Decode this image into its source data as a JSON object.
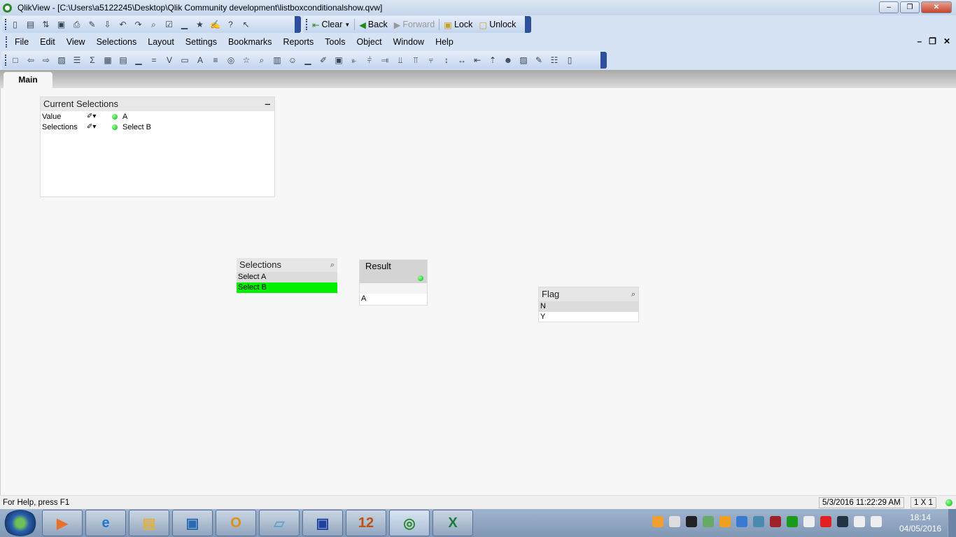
{
  "window": {
    "title": "QlikView - [C:\\Users\\a5122245\\Desktop\\Qlik Community development\\listboxconditionalshow.qvw]",
    "min": "–",
    "max": "❐",
    "close": "✕"
  },
  "toolbar_standard": [
    {
      "n": "new-icon",
      "g": "▯"
    },
    {
      "n": "open-icon",
      "g": "▤"
    },
    {
      "n": "reload-icon",
      "g": "⇅"
    },
    {
      "n": "save-icon",
      "g": "▣"
    },
    {
      "n": "print-icon",
      "g": "⎙"
    },
    {
      "n": "edit-script-icon",
      "g": "✎"
    },
    {
      "n": "reload-data-icon",
      "g": "⇩"
    },
    {
      "n": "undo-icon",
      "g": "↶"
    },
    {
      "n": "redo-icon",
      "g": "↷"
    },
    {
      "n": "search-icon",
      "g": "⌕"
    },
    {
      "n": "checkmark-icon",
      "g": "☑"
    },
    {
      "n": "chart-wizard-icon",
      "g": "▁"
    },
    {
      "n": "bookmark-star-icon",
      "g": "★"
    },
    {
      "n": "notes-icon",
      "g": "✍"
    },
    {
      "n": "help-icon",
      "g": "?"
    },
    {
      "n": "context-help-icon",
      "g": "↖"
    }
  ],
  "navigation": {
    "clear": "Clear",
    "back": "Back",
    "forward": "Forward",
    "lock": "Lock",
    "unlock": "Unlock"
  },
  "menu": [
    "File",
    "Edit",
    "View",
    "Selections",
    "Layout",
    "Settings",
    "Bookmarks",
    "Reports",
    "Tools",
    "Object",
    "Window",
    "Help"
  ],
  "mdi": {
    "min": "–",
    "restore": "❐",
    "close": "✕"
  },
  "toolbar_design": [
    {
      "n": "new-sheet-icon",
      "g": "□"
    },
    {
      "n": "promote-sheet-icon",
      "g": "⇦"
    },
    {
      "n": "demote-sheet-icon",
      "g": "⇨"
    },
    {
      "n": "sheet-properties-icon",
      "g": "▨"
    },
    {
      "n": "listbox-icon",
      "g": "☰"
    },
    {
      "n": "statistics-box-icon",
      "g": "Σ"
    },
    {
      "n": "multibox-icon",
      "g": "▦"
    },
    {
      "n": "table-box-icon",
      "g": "▤"
    },
    {
      "n": "chart-icon",
      "g": "▁"
    },
    {
      "n": "input-box-icon",
      "g": "="
    },
    {
      "n": "current-selections-icon",
      "g": "V"
    },
    {
      "n": "button-icon",
      "g": "▭"
    },
    {
      "n": "text-object-icon",
      "g": "A"
    },
    {
      "n": "line-arrow-icon",
      "g": "≡"
    },
    {
      "n": "slider-icon",
      "g": "◎"
    },
    {
      "n": "bookmark-object-icon",
      "g": "☆"
    },
    {
      "n": "search-object-icon",
      "g": "⌕"
    },
    {
      "n": "container-icon",
      "g": "▥"
    },
    {
      "n": "custom-object-icon",
      "g": "☺"
    },
    {
      "n": "quick-chart-icon",
      "g": "▁"
    },
    {
      "n": "format-painter-icon",
      "g": "✐"
    },
    {
      "n": "grid-icon",
      "g": "▣"
    },
    {
      "n": "align-left-icon",
      "g": "⫦"
    },
    {
      "n": "align-center-icon",
      "g": "⫩"
    },
    {
      "n": "align-right-icon",
      "g": "⫥"
    },
    {
      "n": "align-bottom-icon",
      "g": "⫫"
    },
    {
      "n": "align-middle-icon",
      "g": "⫪"
    },
    {
      "n": "align-top-icon",
      "g": "⫧"
    },
    {
      "n": "space-vertical-icon",
      "g": "↕"
    },
    {
      "n": "space-horizontal-icon",
      "g": "↔"
    },
    {
      "n": "distribute-left-icon",
      "g": "⇤"
    },
    {
      "n": "distribute-up-icon",
      "g": "⇡"
    },
    {
      "n": "user-icon",
      "g": "☻"
    },
    {
      "n": "expressions-icon",
      "g": "▨"
    },
    {
      "n": "edit-module-icon",
      "g": "✎"
    },
    {
      "n": "connect-icon",
      "g": "☷"
    },
    {
      "n": "document-add-icon",
      "g": "▯"
    }
  ],
  "tabs": [
    "Main"
  ],
  "current_selections": {
    "title": "Current Selections",
    "rows": [
      {
        "field": "Value",
        "value": "A"
      },
      {
        "field": "Selections",
        "value": "Select B"
      }
    ]
  },
  "selections_listbox": {
    "title": "Selections",
    "items": [
      "Select A",
      "Select B"
    ]
  },
  "result_table": {
    "title": "Result",
    "rows": [
      "",
      "A"
    ]
  },
  "flag_listbox": {
    "title": "Flag",
    "items": [
      "N",
      "Y"
    ]
  },
  "status": {
    "help": "For Help, press F1",
    "datetime": "5/3/2016 11:22:29 AM",
    "grid": "1 X 1"
  },
  "taskbar": {
    "time": "18:14",
    "date": "04/05/2016",
    "apps": [
      {
        "n": "media-player",
        "g": "▶",
        "c": "#e8702a"
      },
      {
        "n": "internet-explorer",
        "g": "e",
        "c": "#1e78d0"
      },
      {
        "n": "file-explorer",
        "g": "▤",
        "c": "#e0b040"
      },
      {
        "n": "remote-desktop",
        "g": "▣",
        "c": "#2a6ab0"
      },
      {
        "n": "outlook",
        "g": "O",
        "c": "#e09010"
      },
      {
        "n": "notepad",
        "g": "▱",
        "c": "#6aa0c8"
      },
      {
        "n": "network",
        "g": "▣",
        "c": "#2040a0"
      },
      {
        "n": "calendar",
        "g": "12",
        "c": "#c05010"
      },
      {
        "n": "qlikview",
        "g": "◎",
        "c": "#2a8a2a",
        "active": true
      },
      {
        "n": "excel",
        "g": "X",
        "c": "#1d7a3a"
      }
    ],
    "tray": [
      {
        "n": "update-alert",
        "c": "#f0a030"
      },
      {
        "n": "tg",
        "c": "#ddd"
      },
      {
        "n": "pirate",
        "c": "#222"
      },
      {
        "n": "media",
        "c": "#6a6"
      },
      {
        "n": "office",
        "c": "#f0a020"
      },
      {
        "n": "exchange",
        "c": "#3a7ad0"
      },
      {
        "n": "browser",
        "c": "#4a8ab0"
      },
      {
        "n": "mcafee",
        "c": "#a0202a"
      },
      {
        "n": "sync",
        "c": "#1a9a1a"
      },
      {
        "n": "network",
        "c": "#eee"
      },
      {
        "n": "oracle",
        "c": "#e02020"
      },
      {
        "n": "display",
        "c": "#234"
      },
      {
        "n": "power",
        "c": "#eee"
      },
      {
        "n": "volume",
        "c": "#eee"
      }
    ]
  }
}
